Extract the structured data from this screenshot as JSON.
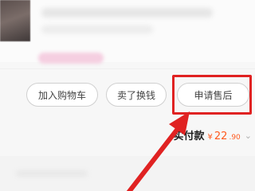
{
  "order_actions": {
    "add_to_cart_label": "加入购物车",
    "resell_label": "卖了换钱",
    "after_sales_label": "申请售后"
  },
  "payment": {
    "paid_label": "实付款",
    "currency_symbol": "¥",
    "amount_integer": "22",
    "amount_decimal": ".90",
    "chevron_icon": "chevron-down-icon"
  },
  "annotation": {
    "highlight_color": "#e02222",
    "arrow_icon": "pointer-arrow-icon"
  },
  "colors": {
    "price_accent": "#ff5a1f",
    "button_border": "#d0d0d0"
  }
}
